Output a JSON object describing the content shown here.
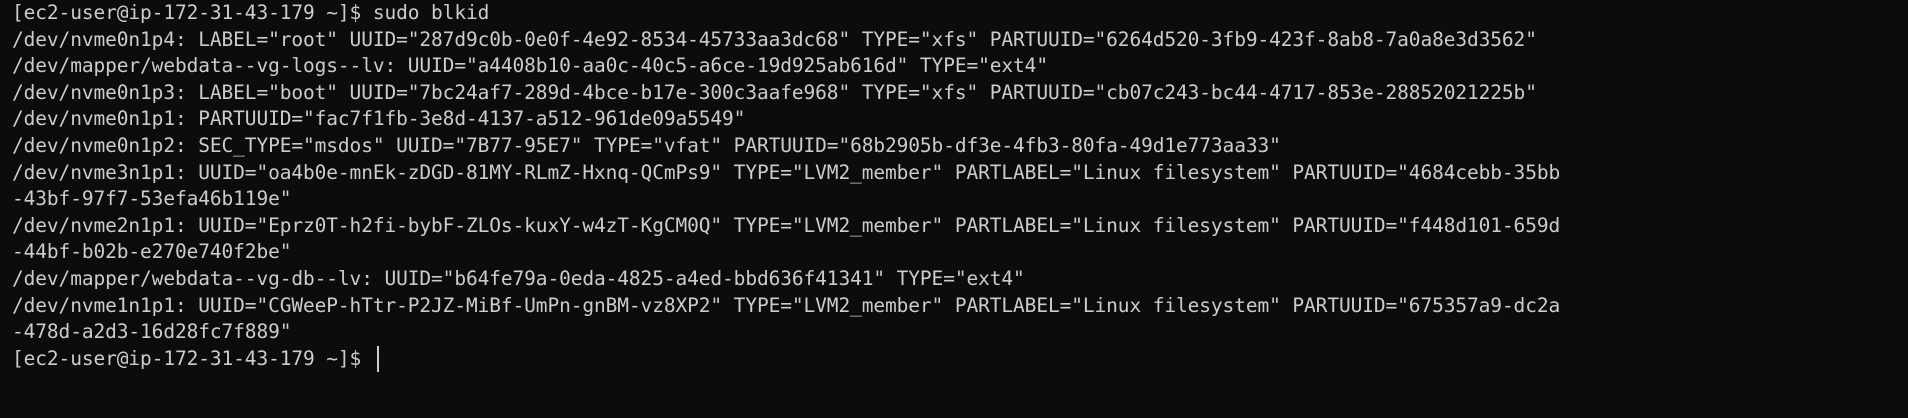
{
  "colors": {
    "background": "#0c0c0c",
    "foreground": "#cccccc"
  },
  "terminal": {
    "command_prompt": "[ec2-user@ip-172-31-43-179 ~]$ ",
    "command": "sudo blkid",
    "output_lines": [
      "/dev/nvme0n1p4: LABEL=\"root\" UUID=\"287d9c0b-0e0f-4e92-8534-45733aa3dc68\" TYPE=\"xfs\" PARTUUID=\"6264d520-3fb9-423f-8ab8-7a0a8e3d3562\"",
      "/dev/mapper/webdata--vg-logs--lv: UUID=\"a4408b10-aa0c-40c5-a6ce-19d925ab616d\" TYPE=\"ext4\"",
      "/dev/nvme0n1p3: LABEL=\"boot\" UUID=\"7bc24af7-289d-4bce-b17e-300c3aafe968\" TYPE=\"xfs\" PARTUUID=\"cb07c243-bc44-4717-853e-28852021225b\"",
      "/dev/nvme0n1p1: PARTUUID=\"fac7f1fb-3e8d-4137-a512-961de09a5549\"",
      "/dev/nvme0n1p2: SEC_TYPE=\"msdos\" UUID=\"7B77-95E7\" TYPE=\"vfat\" PARTUUID=\"68b2905b-df3e-4fb3-80fa-49d1e773aa33\"",
      "/dev/nvme3n1p1: UUID=\"oa4b0e-mnEk-zDGD-81MY-RLmZ-Hxnq-QCmPs9\" TYPE=\"LVM2_member\" PARTLABEL=\"Linux filesystem\" PARTUUID=\"4684cebb-35bb",
      "-43bf-97f7-53efa46b119e\"",
      "/dev/nvme2n1p1: UUID=\"Eprz0T-h2fi-bybF-ZLOs-kuxY-w4zT-KgCM0Q\" TYPE=\"LVM2_member\" PARTLABEL=\"Linux filesystem\" PARTUUID=\"f448d101-659d",
      "-44bf-b02b-e270e740f2be\"",
      "/dev/mapper/webdata--vg-db--lv: UUID=\"b64fe79a-0eda-4825-a4ed-bbd636f41341\" TYPE=\"ext4\"",
      "/dev/nvme1n1p1: UUID=\"CGWeeP-hTtr-P2JZ-MiBf-UmPn-gnBM-vz8XP2\" TYPE=\"LVM2_member\" PARTLABEL=\"Linux filesystem\" PARTUUID=\"675357a9-dc2a",
      "-478d-a2d3-16d28fc7f889\""
    ],
    "final_prompt": "[ec2-user@ip-172-31-43-179 ~]$ "
  }
}
